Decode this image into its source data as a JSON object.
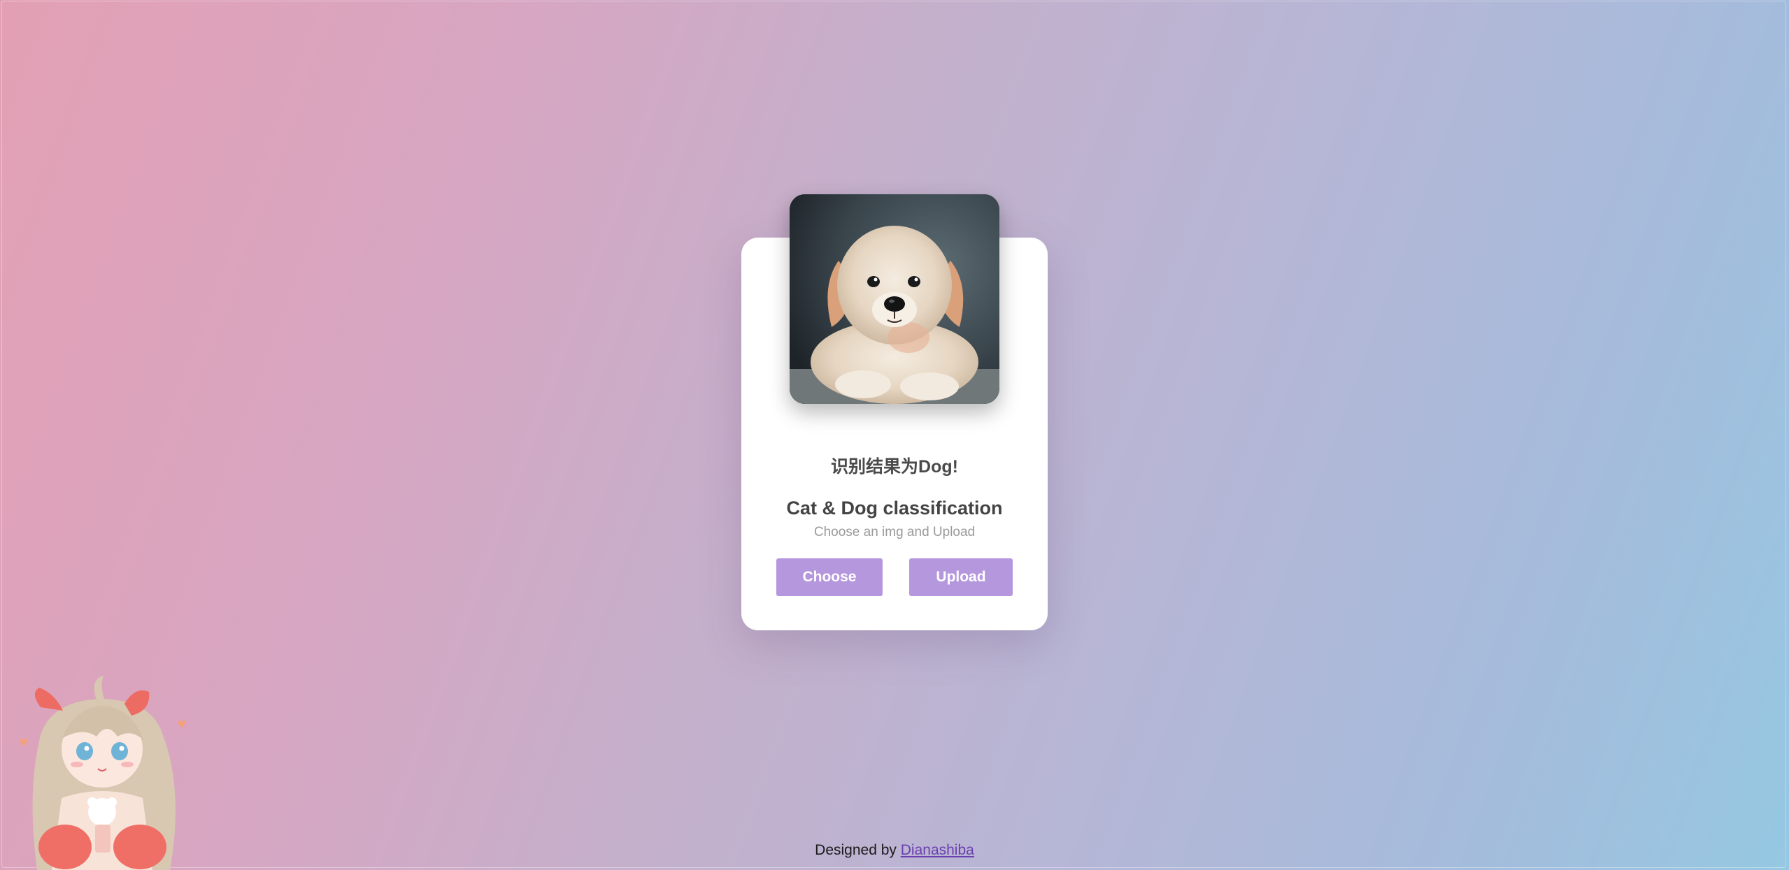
{
  "card": {
    "result_text": "识别结果为Dog!",
    "title": "Cat & Dog classification",
    "subtitle": "Choose an img and Upload",
    "choose_label": "Choose",
    "upload_label": "Upload",
    "image_subject": "puppy"
  },
  "footer": {
    "prefix": "Designed by ",
    "author": "Dianashiba"
  },
  "colors": {
    "accent_button": "#b497dd",
    "link": "#6a3fb0",
    "card_bg": "#ffffff",
    "gradient_left": "#e3a0b4",
    "gradient_right": "#95c8e2"
  }
}
